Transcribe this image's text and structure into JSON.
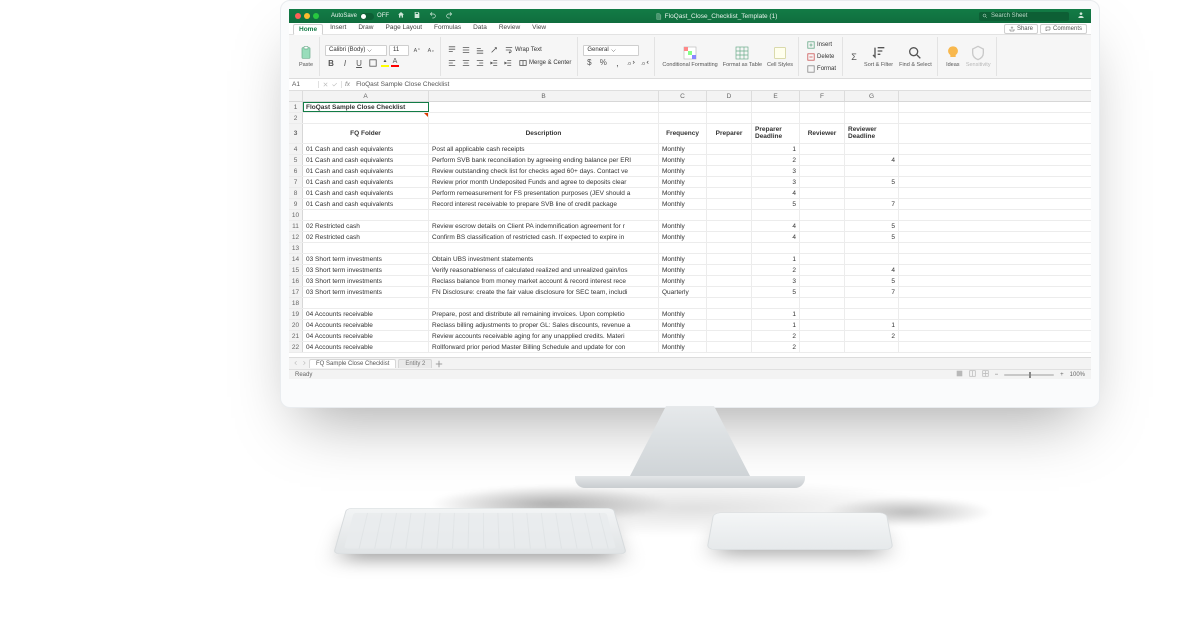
{
  "titlebar": {
    "autosave_label": "AutoSave",
    "autosave_state": "OFF",
    "filename": "FloQast_Close_Checklist_Template (1)",
    "search_placeholder": "Search Sheet"
  },
  "menubar": {
    "tabs": [
      "Home",
      "Insert",
      "Draw",
      "Page Layout",
      "Formulas",
      "Data",
      "Review",
      "View"
    ],
    "share": "Share",
    "comments": "Comments"
  },
  "ribbon": {
    "paste": "Paste",
    "font_name": "Calibri (Body)",
    "font_size": "11",
    "wrap": "Wrap Text",
    "merge": "Merge & Center",
    "num_format": "General",
    "cond": "Conditional Formatting",
    "fat": "Format as Table",
    "styles": "Cell Styles",
    "insert": "Insert",
    "delete": "Delete",
    "format": "Format",
    "sortfilter": "Sort & Filter",
    "findselect": "Find & Select",
    "ideas": "Ideas",
    "sensitivity": "Sensitivity"
  },
  "formula_bar": {
    "cell_ref": "A1",
    "value": "FloQast Sample Close Checklist"
  },
  "columns": [
    "A",
    "B",
    "C",
    "D",
    "E",
    "F",
    "G"
  ],
  "header_row": [
    "FQ Folder",
    "Description",
    "Frequency",
    "Preparer",
    "Preparer Deadline",
    "Reviewer",
    "Reviewer Deadline"
  ],
  "title_cell": "FloQast Sample Close Checklist",
  "rows": [
    {
      "n": 4,
      "a": "01 Cash and cash equivalents",
      "b": "Post all applicable cash receipts",
      "c": "Monthly",
      "d": "",
      "e": "1",
      "f": "",
      "g": ""
    },
    {
      "n": 5,
      "a": "01 Cash and cash equivalents",
      "b": "Perform SVB bank reconciliation by agreeing ending balance per ERI",
      "c": "Monthly",
      "d": "",
      "e": "2",
      "f": "",
      "g": "4"
    },
    {
      "n": 6,
      "a": "01 Cash and cash equivalents",
      "b": "Review outstanding check list for checks aged 60+ days. Contact ve",
      "c": "Monthly",
      "d": "",
      "e": "3",
      "f": "",
      "g": ""
    },
    {
      "n": 7,
      "a": "01 Cash and cash equivalents",
      "b": "Review prior month Undeposited Funds and agree to deposits clear",
      "c": "Monthly",
      "d": "",
      "e": "3",
      "f": "",
      "g": "5"
    },
    {
      "n": 8,
      "a": "01 Cash and cash equivalents",
      "b": "Perform remeasurement for FS presentation purposes (JEV should a",
      "c": "Monthly",
      "d": "",
      "e": "4",
      "f": "",
      "g": ""
    },
    {
      "n": 9,
      "a": "01 Cash and cash equivalents",
      "b": "Record interest receivable to prepare SVB line of credit package",
      "c": "Monthly",
      "d": "",
      "e": "5",
      "f": "",
      "g": "7"
    },
    {
      "n": 10,
      "a": "",
      "b": "",
      "c": "",
      "d": "",
      "e": "",
      "f": "",
      "g": ""
    },
    {
      "n": 11,
      "a": "02 Restricted cash",
      "b": "Review escrow details on Client PA indemnification agreement for r",
      "c": "Monthly",
      "d": "",
      "e": "4",
      "f": "",
      "g": "5"
    },
    {
      "n": 12,
      "a": "02 Restricted cash",
      "b": "Confirm BS classification of restricted cash. If expected to expire in",
      "c": "Monthly",
      "d": "",
      "e": "4",
      "f": "",
      "g": "5"
    },
    {
      "n": 13,
      "a": "",
      "b": "",
      "c": "",
      "d": "",
      "e": "",
      "f": "",
      "g": ""
    },
    {
      "n": 14,
      "a": "03 Short term investments",
      "b": "Obtain UBS investment statements",
      "c": "Monthly",
      "d": "",
      "e": "1",
      "f": "",
      "g": ""
    },
    {
      "n": 15,
      "a": "03 Short term investments",
      "b": "Verify reasonableness of calculated realized and unrealized gain/los",
      "c": "Monthly",
      "d": "",
      "e": "2",
      "f": "",
      "g": "4"
    },
    {
      "n": 16,
      "a": "03 Short term investments",
      "b": "Reclass balance from money market account & record interest rece",
      "c": "Monthly",
      "d": "",
      "e": "3",
      "f": "",
      "g": "5"
    },
    {
      "n": 17,
      "a": "03 Short term investments",
      "b": "FN Disclosure: create the fair value disclosure for SEC team, includi",
      "c": "Quarterly",
      "d": "",
      "e": "5",
      "f": "",
      "g": "7"
    },
    {
      "n": 18,
      "a": "",
      "b": "",
      "c": "",
      "d": "",
      "e": "",
      "f": "",
      "g": ""
    },
    {
      "n": 19,
      "a": "04 Accounts receivable",
      "b": "Prepare, post and distribute all remaining invoices. Upon completio",
      "c": "Monthly",
      "d": "",
      "e": "1",
      "f": "",
      "g": ""
    },
    {
      "n": 20,
      "a": "04 Accounts receivable",
      "b": "Reclass billing adjustments to proper GL: Sales discounts, revenue a",
      "c": "Monthly",
      "d": "",
      "e": "1",
      "f": "",
      "g": "1"
    },
    {
      "n": 21,
      "a": "04 Accounts receivable",
      "b": "Review accounts receivable aging for any unapplied credits. Materi",
      "c": "Monthly",
      "d": "",
      "e": "2",
      "f": "",
      "g": "2"
    },
    {
      "n": 22,
      "a": "04 Accounts receivable",
      "b": "Rollforward prior period Master Billing Schedule and update for con",
      "c": "Monthly",
      "d": "",
      "e": "2",
      "f": "",
      "g": ""
    }
  ],
  "sheets": {
    "active": "FQ Sample Close Checklist",
    "other": "Entity 2"
  },
  "status": {
    "ready": "Ready",
    "zoom": "100%"
  }
}
